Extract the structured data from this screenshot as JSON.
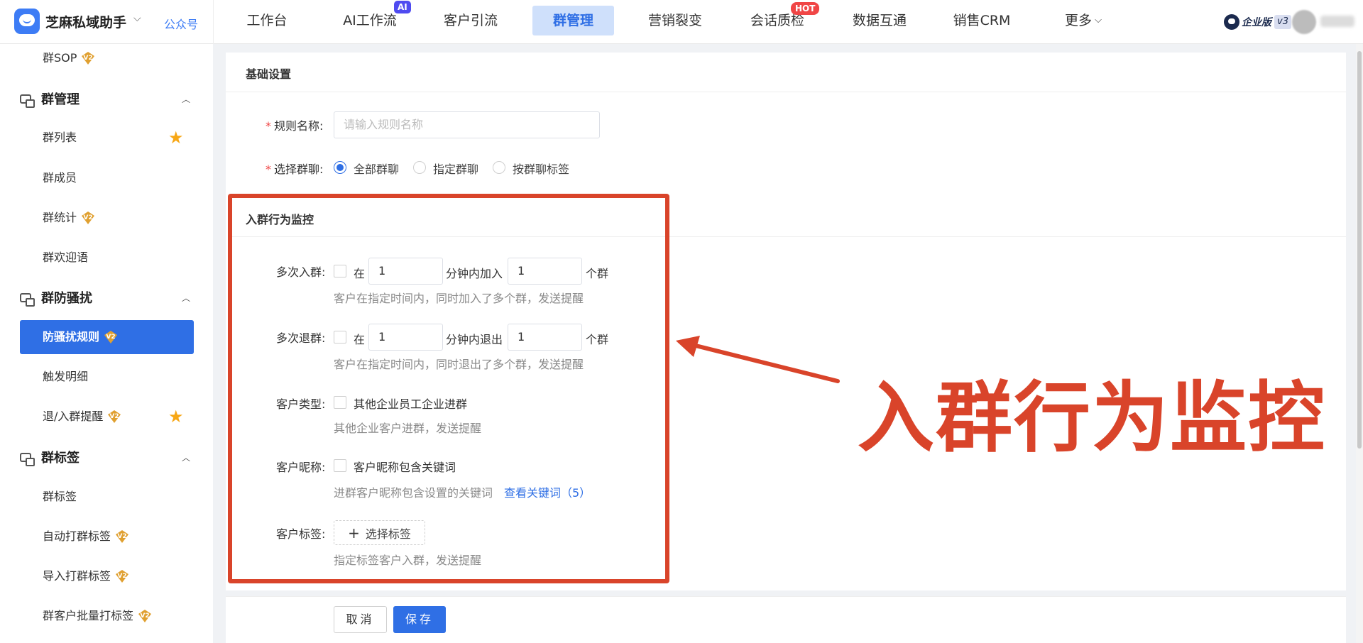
{
  "header": {
    "app_name": "芝麻私域助手",
    "gzh_link": "公众号",
    "nav": [
      {
        "label": "工作台"
      },
      {
        "label": "AI工作流",
        "badge": "AI"
      },
      {
        "label": "客户引流"
      },
      {
        "label": "群管理",
        "active": true
      },
      {
        "label": "营销裂变"
      },
      {
        "label": "会话质检",
        "badge": "HOT"
      },
      {
        "label": "数据互通"
      },
      {
        "label": "销售CRM"
      },
      {
        "label": "更多"
      }
    ],
    "enterprise_label": "企业版",
    "enterprise_version": "v3"
  },
  "sidebar": {
    "items": [
      {
        "label": "群SOP",
        "v2": true
      },
      {
        "section": "群管理"
      },
      {
        "label": "群列表",
        "starred": true
      },
      {
        "label": "群成员"
      },
      {
        "label": "群统计",
        "v2": true
      },
      {
        "label": "群欢迎语"
      },
      {
        "section": "群防骚扰"
      },
      {
        "label": "防骚扰规则",
        "v2": true,
        "active": true
      },
      {
        "label": "触发明细"
      },
      {
        "label": "退/入群提醒",
        "v2": true,
        "starred": true
      },
      {
        "section": "群标签"
      },
      {
        "label": "群标签"
      },
      {
        "label": "自动打群标签",
        "v2": true
      },
      {
        "label": "导入打群标签",
        "v2": true
      },
      {
        "label": "群客户批量打标签",
        "v2": true
      }
    ]
  },
  "form": {
    "section_title": "基础设置",
    "rule_name_label": "规则名称:",
    "rule_name_placeholder": "请输入规则名称",
    "group_select_label": "选择群聊:",
    "group_options": [
      "全部群聊",
      "指定群聊",
      "按群聊标签"
    ],
    "group_selected": "全部群聊",
    "monitor_title": "入群行为监控",
    "multi_join": {
      "label": "多次入群:",
      "prefix": "在",
      "minutes": "1",
      "middle": "分钟内加入",
      "count": "1",
      "suffix": "个群",
      "hint": "客户在指定时间内，同时加入了多个群，发送提醒"
    },
    "multi_leave": {
      "label": "多次退群:",
      "prefix": "在",
      "minutes": "1",
      "middle": "分钟内退出",
      "count": "1",
      "suffix": "个群",
      "hint": "客户在指定时间内，同时退出了多个群，发送提醒"
    },
    "customer_type": {
      "label": "客户类型:",
      "option": "其他企业员工企业进群",
      "hint": "其他企业客户进群，发送提醒"
    },
    "nickname": {
      "label": "客户昵称:",
      "option": "客户昵称包含关键词",
      "hint": "进群客户昵称包含设置的关键词",
      "link": "查看关键词（5）"
    },
    "customer_tag": {
      "label": "客户标签:",
      "button": "选择标签",
      "hint": "指定标签客户入群，发送提醒"
    },
    "cancel": "取消",
    "save": "保存"
  },
  "annotation": {
    "text": "入群行为监控",
    "color": "#d9442a"
  },
  "colors": {
    "primary": "#2f6fe5",
    "danger": "#f04646",
    "star": "#f7a716"
  }
}
